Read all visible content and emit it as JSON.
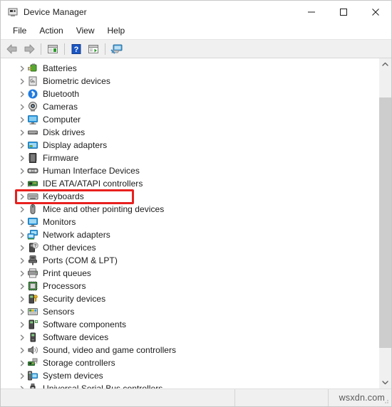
{
  "window": {
    "title": "Device Manager",
    "title_icon": "device-manager-icon"
  },
  "caption": {
    "minimize": "minimize-icon",
    "maximize": "maximize-icon",
    "close": "close-icon"
  },
  "menubar": {
    "items": [
      {
        "label": "File"
      },
      {
        "label": "Action"
      },
      {
        "label": "View"
      },
      {
        "label": "Help"
      }
    ]
  },
  "toolbar": {
    "buttons": [
      {
        "name": "back-button",
        "icon": "back-arrow-icon"
      },
      {
        "name": "forward-button",
        "icon": "forward-arrow-icon"
      },
      {
        "name": "show-hide-console-tree-button",
        "icon": "console-tree-icon"
      },
      {
        "name": "help-button",
        "icon": "help-question-icon"
      },
      {
        "name": "properties-button",
        "icon": "properties-icon"
      },
      {
        "name": "scan-hardware-changes-button",
        "icon": "scan-monitor-icon"
      }
    ]
  },
  "tree": {
    "items": [
      {
        "label": "Batteries",
        "icon": "battery-icon",
        "expanded": false
      },
      {
        "label": "Biometric devices",
        "icon": "fingerprint-icon",
        "expanded": false
      },
      {
        "label": "Bluetooth",
        "icon": "bluetooth-icon",
        "expanded": false
      },
      {
        "label": "Cameras",
        "icon": "camera-icon",
        "expanded": false
      },
      {
        "label": "Computer",
        "icon": "computer-icon",
        "expanded": false
      },
      {
        "label": "Disk drives",
        "icon": "disk-drive-icon",
        "expanded": false
      },
      {
        "label": "Display adapters",
        "icon": "display-adapter-icon",
        "expanded": false
      },
      {
        "label": "Firmware",
        "icon": "firmware-icon",
        "expanded": false
      },
      {
        "label": "Human Interface Devices",
        "icon": "hid-icon",
        "expanded": false
      },
      {
        "label": "IDE ATA/ATAPI controllers",
        "icon": "ide-controller-icon",
        "expanded": false
      },
      {
        "label": "Keyboards",
        "icon": "keyboard-icon",
        "expanded": false,
        "highlighted": true
      },
      {
        "label": "Mice and other pointing devices",
        "icon": "mouse-icon",
        "expanded": false
      },
      {
        "label": "Monitors",
        "icon": "monitor-icon",
        "expanded": false
      },
      {
        "label": "Network adapters",
        "icon": "network-adapter-icon",
        "expanded": false
      },
      {
        "label": "Other devices",
        "icon": "other-devices-icon",
        "expanded": false
      },
      {
        "label": "Ports (COM & LPT)",
        "icon": "port-icon",
        "expanded": false
      },
      {
        "label": "Print queues",
        "icon": "printer-icon",
        "expanded": false
      },
      {
        "label": "Processors",
        "icon": "processor-icon",
        "expanded": false
      },
      {
        "label": "Security devices",
        "icon": "security-device-icon",
        "expanded": false
      },
      {
        "label": "Sensors",
        "icon": "sensor-icon",
        "expanded": false
      },
      {
        "label": "Software components",
        "icon": "software-component-icon",
        "expanded": false
      },
      {
        "label": "Software devices",
        "icon": "software-device-icon",
        "expanded": false
      },
      {
        "label": "Sound, video and game controllers",
        "icon": "sound-controller-icon",
        "expanded": false
      },
      {
        "label": "Storage controllers",
        "icon": "storage-controller-icon",
        "expanded": false
      },
      {
        "label": "System devices",
        "icon": "system-device-icon",
        "expanded": false
      },
      {
        "label": "Universal Serial Bus controllers",
        "icon": "usb-controller-icon",
        "expanded": false
      }
    ]
  },
  "scrollbar": {
    "up_arrow": "chevron-up-icon",
    "down_arrow": "chevron-down-icon"
  },
  "statusbar": {
    "pane1": "",
    "pane2": "",
    "watermark": "wsxdn.com"
  },
  "colors": {
    "highlight_red": "#e8201e",
    "chrome_gray": "#f0f0f0",
    "text": "#1b1b1b",
    "scroll_thumb": "#cdcdcd"
  }
}
